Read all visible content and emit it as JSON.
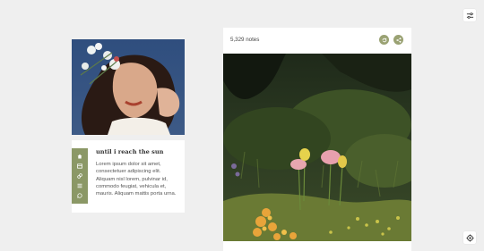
{
  "blog": {
    "title": "until i reach the sun",
    "description": "Lorem ipsum dolor sit amet, consectetuer adipiscing elit. Aliquam nisl lorem, pulvinar id, commodo feugiat, vehicula et, mauris. Aliquam mattis porta urna.",
    "sidebar_icons": [
      "home-icon",
      "archive-icon",
      "link-icon",
      "list-icon",
      "message-icon"
    ]
  },
  "post": {
    "notes": "5,329 notes",
    "actions": [
      "reblog-icon",
      "share-icon"
    ]
  },
  "controls": {
    "top_right": "filter-icon",
    "bottom_right": "theme-icon"
  },
  "colors": {
    "background": "#efefef",
    "accent": "#8b9866",
    "card": "#ffffff"
  }
}
